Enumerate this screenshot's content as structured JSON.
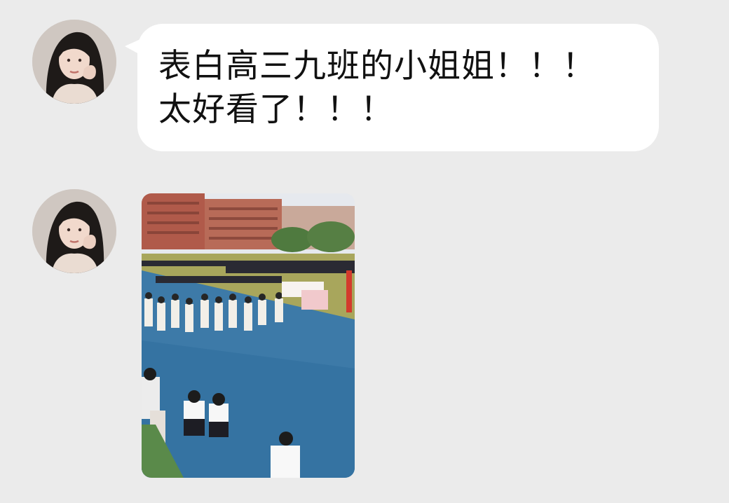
{
  "conversation": {
    "messages": [
      {
        "type": "text",
        "sender": "contact",
        "avatar_icon": "woman-portrait-avatar",
        "text": "表白高三九班的小姐姐！！！\n太好看了！！！"
      },
      {
        "type": "image",
        "sender": "contact",
        "avatar_icon": "woman-portrait-avatar",
        "image_icon": "school-sports-field-photo"
      }
    ]
  },
  "colors": {
    "background": "#ebebeb",
    "bubble": "#ffffff",
    "text": "#111111"
  }
}
